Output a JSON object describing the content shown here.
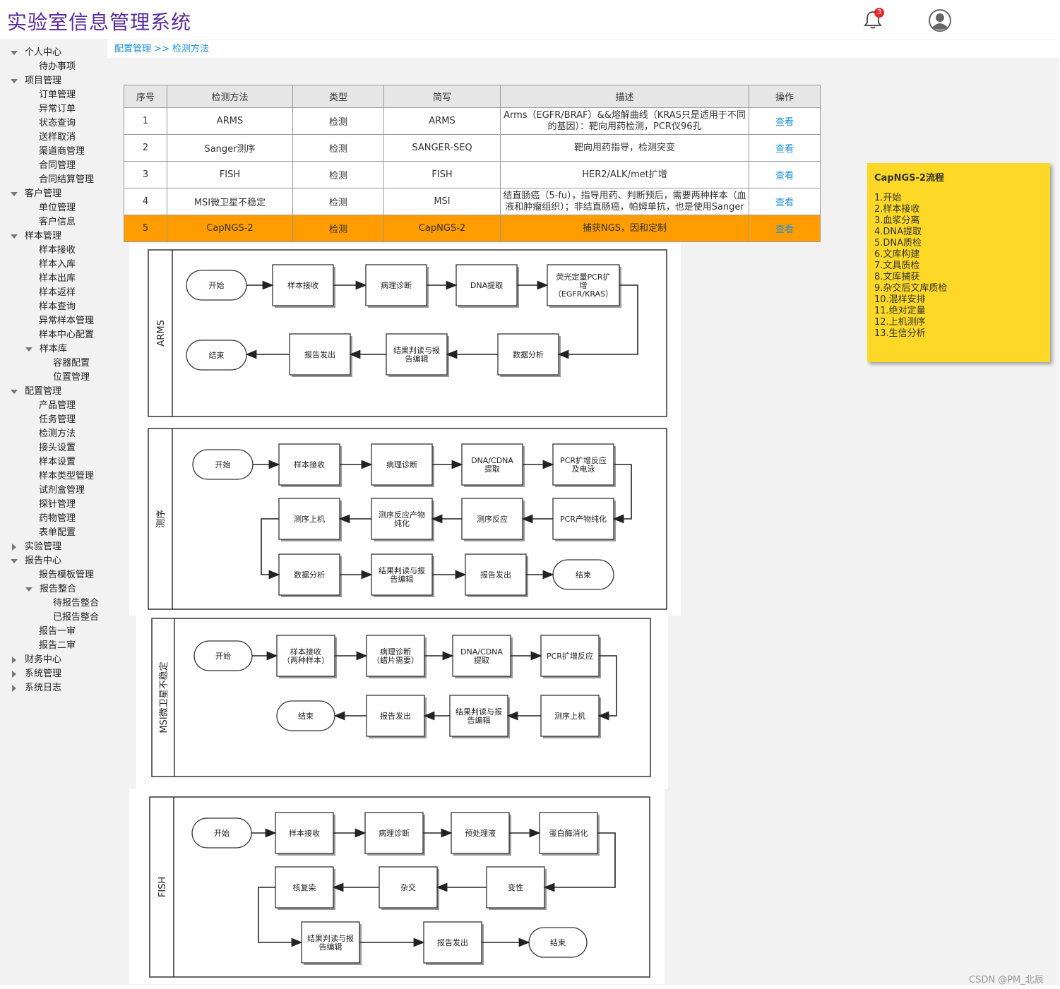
{
  "app": {
    "title": "实验室信息管理系统",
    "notification_count": "3"
  },
  "breadcrumb": "配置管理 >> 检测方法",
  "sidebar": [
    {
      "label": "个人中心",
      "level": 0,
      "state": "open"
    },
    {
      "label": "待办事项",
      "level": 1
    },
    {
      "label": "项目管理",
      "level": 0,
      "state": "open"
    },
    {
      "label": "订单管理",
      "level": 1
    },
    {
      "label": "异常订单",
      "level": 1
    },
    {
      "label": "状态查询",
      "level": 1
    },
    {
      "label": "送样取消",
      "level": 1
    },
    {
      "label": "渠道商管理",
      "level": 1
    },
    {
      "label": "合同管理",
      "level": 1
    },
    {
      "label": "合同结算管理",
      "level": 1
    },
    {
      "label": "客户管理",
      "level": 0,
      "state": "open"
    },
    {
      "label": "单位管理",
      "level": 1
    },
    {
      "label": "客户信息",
      "level": 1
    },
    {
      "label": "样本管理",
      "level": 0,
      "state": "open"
    },
    {
      "label": "样本接收",
      "level": 1
    },
    {
      "label": "样本入库",
      "level": 1
    },
    {
      "label": "样本出库",
      "level": 1
    },
    {
      "label": "样本返样",
      "level": 1
    },
    {
      "label": "样本查询",
      "level": 1
    },
    {
      "label": "异常样本管理",
      "level": 1
    },
    {
      "label": "样本中心配置",
      "level": 1
    },
    {
      "label": "样本库",
      "level": 1,
      "state": "open"
    },
    {
      "label": "容器配置",
      "level": 2
    },
    {
      "label": "位置管理",
      "level": 2
    },
    {
      "label": "配置管理",
      "level": 0,
      "state": "open"
    },
    {
      "label": "产品管理",
      "level": 1
    },
    {
      "label": "任务管理",
      "level": 1
    },
    {
      "label": "检测方法",
      "level": 1
    },
    {
      "label": "接头设置",
      "level": 1
    },
    {
      "label": "样本设置",
      "level": 1
    },
    {
      "label": "样本类型管理",
      "level": 1
    },
    {
      "label": "试剂盒管理",
      "level": 1
    },
    {
      "label": "探针管理",
      "level": 1
    },
    {
      "label": "药物管理",
      "level": 1
    },
    {
      "label": "表单配置",
      "level": 1
    },
    {
      "label": "实验管理",
      "level": 0,
      "state": "closed"
    },
    {
      "label": "报告中心",
      "level": 0,
      "state": "open"
    },
    {
      "label": "报告模板管理",
      "level": 1
    },
    {
      "label": "报告整合",
      "level": 1,
      "state": "open"
    },
    {
      "label": "待报告整合",
      "level": 2
    },
    {
      "label": "已报告整合",
      "level": 2
    },
    {
      "label": "报告一审",
      "level": 1
    },
    {
      "label": "报告二审",
      "level": 1
    },
    {
      "label": "财务中心",
      "level": 0,
      "state": "closed"
    },
    {
      "label": "系统管理",
      "level": 0,
      "state": "closed"
    },
    {
      "label": "系统日志",
      "level": 0,
      "state": "closed"
    }
  ],
  "table": {
    "headers": [
      "序号",
      "检测方法",
      "类型",
      "简写",
      "描述",
      "操作"
    ],
    "rows": [
      {
        "no": "1",
        "method": "ARMS",
        "type": "检测",
        "abbr": "ARMS",
        "desc1": "Arms（EGFR/BRAF）&&熔解曲线（KRAS只是适用于不同",
        "desc2": "的基因）：靶向用药检测，PCR仪96孔",
        "action": "查看",
        "highlight": false
      },
      {
        "no": "2",
        "method": "Sanger测序",
        "type": "检测",
        "abbr": "SANGER-SEQ",
        "desc1": "靶向用药指导，检测突变",
        "desc2": "",
        "action": "查看",
        "highlight": false
      },
      {
        "no": "3",
        "method": "FISH",
        "type": "检测",
        "abbr": "FISH",
        "desc1": "HER2/ALK/met扩增",
        "desc2": "",
        "action": "查看",
        "highlight": false
      },
      {
        "no": "4",
        "method": "MSI微卫星不稳定",
        "type": "检测",
        "abbr": "MSI",
        "desc1": "结直肠癌（5-fu），指导用药、判断预后，需要两种样本（血",
        "desc2": "液和肿瘤组织）；非结直肠癌，帕姆单抗，也是使用Sanger",
        "action": "查看",
        "highlight": false
      },
      {
        "no": "5",
        "method": "CapNGS-2",
        "type": "检测",
        "abbr": "CapNGS-2",
        "desc1": "捕获NGS，因和定制",
        "desc2": "",
        "action": "查看",
        "highlight": true
      }
    ]
  },
  "note": {
    "title": "CapNGS-2流程",
    "steps": [
      "1.开始",
      "2.样本接收",
      "3.血浆分离",
      "4.DNA提取",
      "5.DNA质检",
      "6.文库构建",
      "7.文具质检",
      "8.文库捕获",
      "9.杂交后文库质检",
      "10.混样安排",
      "11.绝对定量",
      "12.上机测序",
      "13.生信分析"
    ]
  },
  "flows": {
    "arms": {
      "lane": "ARMS",
      "nodes": [
        "开始",
        "样本接收",
        "病理诊断",
        "DNA提取",
        "荧光定量PCR扩|增|（EGFR/KRAS）",
        "数据分析",
        "结果判读与报|告编辑",
        "报告发出",
        "结束"
      ]
    },
    "sanger": {
      "lane": "测序",
      "nodes": [
        "开始",
        "样本接收",
        "病理诊断",
        "DNA/CDNA|提取",
        "PCR扩增反应|及电泳",
        "PCR产物纯化",
        "测序反应",
        "测序反应产物|纯化",
        "测序上机",
        "数据分析",
        "结果判读与报|告编辑",
        "报告发出",
        "结束"
      ]
    },
    "msi": {
      "lane": "MSI微卫星不稳定",
      "nodes": [
        "开始",
        "样本接收|（两种样本）",
        "病理诊断|（蜡片需要）",
        "DNA/CDNA|提取",
        "PCR扩增反应",
        "测序上机",
        "结果判读与报|告编辑",
        "报告发出",
        "结束"
      ]
    },
    "fish": {
      "lane": "FISH",
      "nodes": [
        "开始",
        "样本接收",
        "病理诊断",
        "预处理液",
        "蛋白酶消化",
        "变性",
        "杂交",
        "核复染",
        "结果判读与报|告编辑",
        "报告发出",
        "结束"
      ]
    }
  },
  "watermark": "CSDN @PM_北辰"
}
